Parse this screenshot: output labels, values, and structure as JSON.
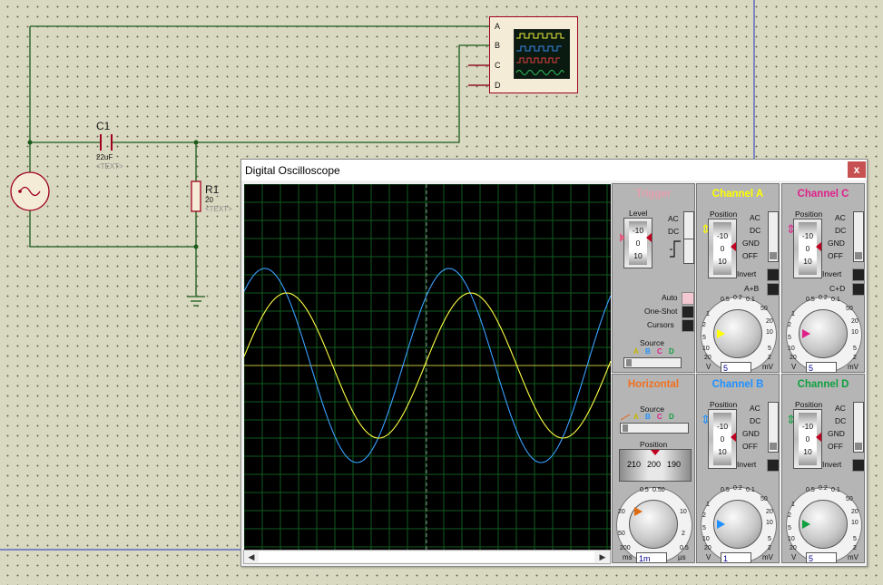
{
  "schematic": {
    "capacitor": {
      "ref": "C1",
      "value": "22uF",
      "text": "<TEXT>"
    },
    "resistor": {
      "ref": "R1",
      "value": "20",
      "text": "<TEXT>"
    },
    "scope_pins": [
      "A",
      "B",
      "C",
      "D"
    ]
  },
  "window": {
    "title": "Digital Oscilloscope",
    "close_label": "x"
  },
  "trigger": {
    "title": "Trigger",
    "level_label": "Level",
    "coupling": [
      "AC",
      "DC"
    ],
    "scale": [
      "-10",
      "0",
      "10"
    ],
    "modes": [
      "Auto",
      "One-Shot",
      "Cursors"
    ],
    "source_label": "Source",
    "source_channels": [
      "A",
      "B",
      "C",
      "D"
    ]
  },
  "horizontal": {
    "title": "Horizontal",
    "source_label": "Source",
    "source_channels": [
      "A",
      "B",
      "C",
      "D"
    ],
    "position_label": "Position",
    "position_scale": [
      "210",
      "200",
      "190"
    ],
    "dial_labels": [
      "0.5",
      "0.2",
      "0.1",
      "0.50",
      "1",
      "2",
      "5",
      "10",
      "20",
      "50",
      "100",
      "200"
    ],
    "units_left": "ms",
    "units_right": "µs",
    "value": "1m"
  },
  "channels": [
    {
      "key": "A",
      "title": "Channel A",
      "color": "#ffff00",
      "coupling": [
        "AC",
        "DC",
        "GND",
        "OFF"
      ],
      "invert": "Invert",
      "extra": "A+B",
      "value": "5",
      "unit_l": "V",
      "unit_r": "mV"
    },
    {
      "key": "C",
      "title": "Channel C",
      "color": "#e0208a",
      "coupling": [
        "AC",
        "DC",
        "GND",
        "OFF"
      ],
      "invert": "Invert",
      "extra": "C+D",
      "value": "5",
      "unit_l": "V",
      "unit_r": "mV"
    },
    {
      "key": "B",
      "title": "Channel B",
      "color": "#1e90ff",
      "coupling": [
        "AC",
        "DC",
        "GND",
        "OFF"
      ],
      "invert": "Invert",
      "extra": "",
      "value": "1",
      "unit_l": "V",
      "unit_r": "mV"
    },
    {
      "key": "D",
      "title": "Channel D",
      "color": "#10a040",
      "coupling": [
        "AC",
        "DC",
        "GND",
        "OFF"
      ],
      "invert": "Invert",
      "extra": "",
      "value": "5",
      "unit_l": "V",
      "unit_r": "mV"
    }
  ],
  "channel_common": {
    "position_label": "Position",
    "scale": [
      "-10",
      "0",
      "10"
    ],
    "dial_labels": [
      "0.5",
      "0.2",
      "0.1",
      "50",
      "20",
      "10",
      "1",
      "2",
      "5",
      "10",
      "5",
      "20",
      "2"
    ]
  },
  "colors": {
    "trace_a": "#ffff44",
    "trace_b": "#3aa0ff",
    "grid": "#0f5a1e",
    "background": "#000000",
    "trigger_title": "#e6a0b0",
    "horizontal_title": "#f07020"
  }
}
